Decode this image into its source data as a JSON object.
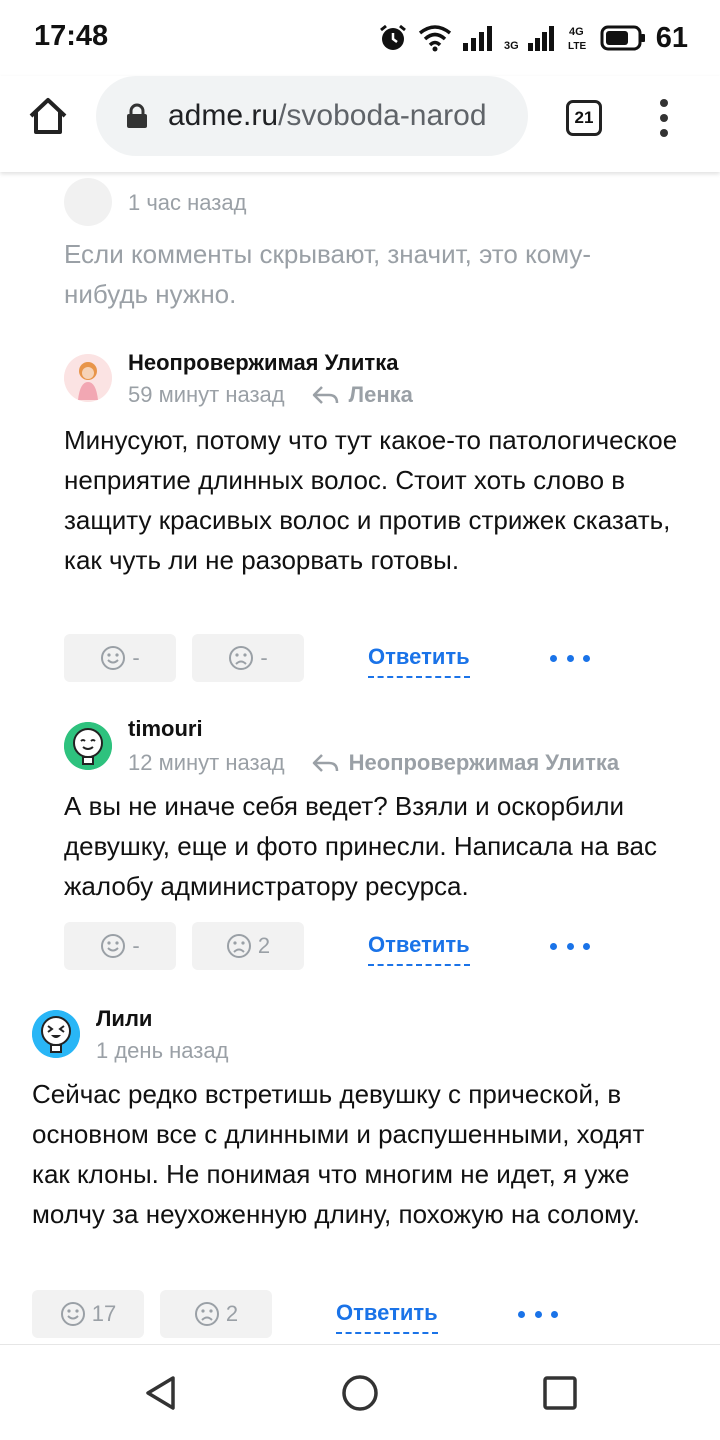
{
  "status_bar": {
    "time": "17:48",
    "battery": "61",
    "icons": [
      "alarm-icon",
      "wifi-icon",
      "signal-icon",
      "3g-signal-icon",
      "4g-lte-icon",
      "battery-icon"
    ]
  },
  "browser": {
    "url_host": "adme.ru",
    "url_path": "/svoboda-narod",
    "tab_count": "21"
  },
  "comments": [
    {
      "time": "1 час назад",
      "text": "Если комменты скрывают, значит, это кому-нибудь нужно."
    },
    {
      "author": "Неопровержимая Улитка",
      "time": "59 минут назад",
      "reply_to": "Ленка",
      "text": "Минусуют, потому что тут какое-то патологическое неприятие длинных волос. Стоит хоть слово в защиту красивых волос и против стрижек сказать, как чуть ли не разорвать готовы.",
      "likes": "-",
      "dislikes": "-",
      "reply_label": "Ответить"
    },
    {
      "author": "timouri",
      "time": "12 минут назад",
      "reply_to": "Неопровержимая Улитка",
      "text": "А вы не иначе себя ведет? Взяли и оскорбили девушку, еще и фото принесли. Написала на вас жалобу администратору ресурса.",
      "likes": "-",
      "dislikes": "2",
      "reply_label": "Ответить"
    },
    {
      "author": "Лили",
      "time": "1 день назад",
      "text": "Сейчас редко встретишь девушку с прической, в основном все с длинными и распушенными, ходят как клоны. Не понимая что многим не идет, я уже молчу за неухоженную длину, похожую на солому.",
      "likes": "17",
      "dislikes": "2",
      "reply_label": "Ответить"
    }
  ],
  "colors": {
    "accent": "#1a73e8",
    "muted": "#9aa0a6",
    "button_bg": "#f2f2f2"
  }
}
